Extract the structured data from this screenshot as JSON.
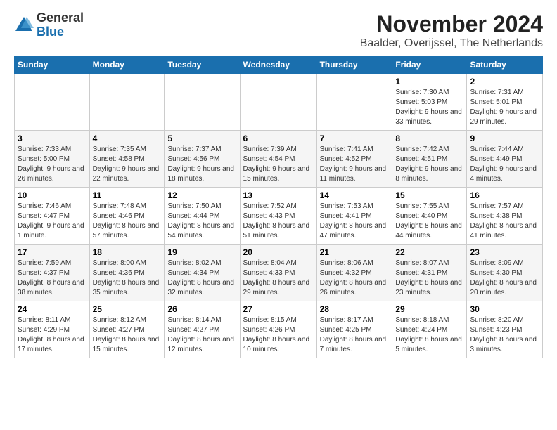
{
  "logo": {
    "general": "General",
    "blue": "Blue"
  },
  "title": "November 2024",
  "location": "Baalder, Overijssel, The Netherlands",
  "weekdays": [
    "Sunday",
    "Monday",
    "Tuesday",
    "Wednesday",
    "Thursday",
    "Friday",
    "Saturday"
  ],
  "weeks": [
    [
      {
        "day": "",
        "info": ""
      },
      {
        "day": "",
        "info": ""
      },
      {
        "day": "",
        "info": ""
      },
      {
        "day": "",
        "info": ""
      },
      {
        "day": "",
        "info": ""
      },
      {
        "day": "1",
        "info": "Sunrise: 7:30 AM\nSunset: 5:03 PM\nDaylight: 9 hours and 33 minutes."
      },
      {
        "day": "2",
        "info": "Sunrise: 7:31 AM\nSunset: 5:01 PM\nDaylight: 9 hours and 29 minutes."
      }
    ],
    [
      {
        "day": "3",
        "info": "Sunrise: 7:33 AM\nSunset: 5:00 PM\nDaylight: 9 hours and 26 minutes."
      },
      {
        "day": "4",
        "info": "Sunrise: 7:35 AM\nSunset: 4:58 PM\nDaylight: 9 hours and 22 minutes."
      },
      {
        "day": "5",
        "info": "Sunrise: 7:37 AM\nSunset: 4:56 PM\nDaylight: 9 hours and 18 minutes."
      },
      {
        "day": "6",
        "info": "Sunrise: 7:39 AM\nSunset: 4:54 PM\nDaylight: 9 hours and 15 minutes."
      },
      {
        "day": "7",
        "info": "Sunrise: 7:41 AM\nSunset: 4:52 PM\nDaylight: 9 hours and 11 minutes."
      },
      {
        "day": "8",
        "info": "Sunrise: 7:42 AM\nSunset: 4:51 PM\nDaylight: 9 hours and 8 minutes."
      },
      {
        "day": "9",
        "info": "Sunrise: 7:44 AM\nSunset: 4:49 PM\nDaylight: 9 hours and 4 minutes."
      }
    ],
    [
      {
        "day": "10",
        "info": "Sunrise: 7:46 AM\nSunset: 4:47 PM\nDaylight: 9 hours and 1 minute."
      },
      {
        "day": "11",
        "info": "Sunrise: 7:48 AM\nSunset: 4:46 PM\nDaylight: 8 hours and 57 minutes."
      },
      {
        "day": "12",
        "info": "Sunrise: 7:50 AM\nSunset: 4:44 PM\nDaylight: 8 hours and 54 minutes."
      },
      {
        "day": "13",
        "info": "Sunrise: 7:52 AM\nSunset: 4:43 PM\nDaylight: 8 hours and 51 minutes."
      },
      {
        "day": "14",
        "info": "Sunrise: 7:53 AM\nSunset: 4:41 PM\nDaylight: 8 hours and 47 minutes."
      },
      {
        "day": "15",
        "info": "Sunrise: 7:55 AM\nSunset: 4:40 PM\nDaylight: 8 hours and 44 minutes."
      },
      {
        "day": "16",
        "info": "Sunrise: 7:57 AM\nSunset: 4:38 PM\nDaylight: 8 hours and 41 minutes."
      }
    ],
    [
      {
        "day": "17",
        "info": "Sunrise: 7:59 AM\nSunset: 4:37 PM\nDaylight: 8 hours and 38 minutes."
      },
      {
        "day": "18",
        "info": "Sunrise: 8:00 AM\nSunset: 4:36 PM\nDaylight: 8 hours and 35 minutes."
      },
      {
        "day": "19",
        "info": "Sunrise: 8:02 AM\nSunset: 4:34 PM\nDaylight: 8 hours and 32 minutes."
      },
      {
        "day": "20",
        "info": "Sunrise: 8:04 AM\nSunset: 4:33 PM\nDaylight: 8 hours and 29 minutes."
      },
      {
        "day": "21",
        "info": "Sunrise: 8:06 AM\nSunset: 4:32 PM\nDaylight: 8 hours and 26 minutes."
      },
      {
        "day": "22",
        "info": "Sunrise: 8:07 AM\nSunset: 4:31 PM\nDaylight: 8 hours and 23 minutes."
      },
      {
        "day": "23",
        "info": "Sunrise: 8:09 AM\nSunset: 4:30 PM\nDaylight: 8 hours and 20 minutes."
      }
    ],
    [
      {
        "day": "24",
        "info": "Sunrise: 8:11 AM\nSunset: 4:29 PM\nDaylight: 8 hours and 17 minutes."
      },
      {
        "day": "25",
        "info": "Sunrise: 8:12 AM\nSunset: 4:27 PM\nDaylight: 8 hours and 15 minutes."
      },
      {
        "day": "26",
        "info": "Sunrise: 8:14 AM\nSunset: 4:27 PM\nDaylight: 8 hours and 12 minutes."
      },
      {
        "day": "27",
        "info": "Sunrise: 8:15 AM\nSunset: 4:26 PM\nDaylight: 8 hours and 10 minutes."
      },
      {
        "day": "28",
        "info": "Sunrise: 8:17 AM\nSunset: 4:25 PM\nDaylight: 8 hours and 7 minutes."
      },
      {
        "day": "29",
        "info": "Sunrise: 8:18 AM\nSunset: 4:24 PM\nDaylight: 8 hours and 5 minutes."
      },
      {
        "day": "30",
        "info": "Sunrise: 8:20 AM\nSunset: 4:23 PM\nDaylight: 8 hours and 3 minutes."
      }
    ]
  ]
}
